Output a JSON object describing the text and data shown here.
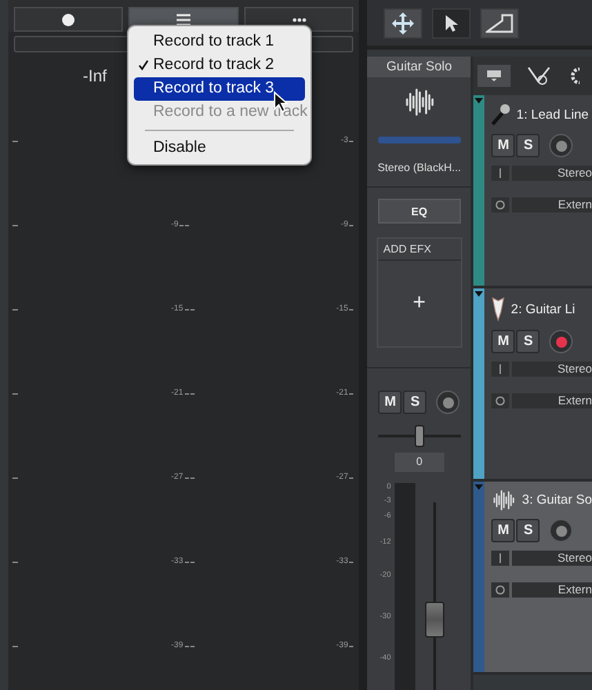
{
  "meter_panel": {
    "peak": "-Inf",
    "center_scale": [
      "-9",
      "-15",
      "-21",
      "-27",
      "-33",
      "-39"
    ],
    "right_scale": [
      "-3",
      "-9",
      "-15",
      "-21",
      "-27",
      "-33",
      "-39"
    ]
  },
  "menu": {
    "items": [
      {
        "kind": "item",
        "label": "Record to track 1",
        "checked": false,
        "selected": false,
        "disabled": false
      },
      {
        "kind": "item",
        "label": "Record to track 2",
        "checked": true,
        "selected": false,
        "disabled": false
      },
      {
        "kind": "item",
        "label": "Record to track 3",
        "checked": false,
        "selected": true,
        "disabled": false
      },
      {
        "kind": "item",
        "label": "Record to a new track",
        "checked": false,
        "selected": false,
        "disabled": true
      },
      {
        "kind": "separator"
      },
      {
        "kind": "item",
        "label": "Disable",
        "checked": false,
        "selected": false,
        "disabled": false
      }
    ]
  },
  "tools": [
    {
      "kind": "move",
      "selected": false
    },
    {
      "kind": "pointer",
      "selected": true
    },
    {
      "kind": "automation",
      "selected": false
    }
  ],
  "channel": {
    "name": "Guitar Solo",
    "output": "Stereo (BlackH...",
    "eq": "EQ",
    "add_efx": "ADD EFX",
    "add": "+",
    "mute": "M",
    "solo": "S",
    "armed": false,
    "pan": {
      "level": 0.5
    },
    "pan_value": "0",
    "scale": [
      "0",
      "-3",
      "-6",
      "-12",
      "-20",
      "-30",
      "-40"
    ],
    "fader": {
      "level": 0.35
    }
  },
  "tracks": [
    {
      "name": "1: Lead Line",
      "kind": "mic",
      "color": "#2e8b84",
      "selected": false,
      "armed": false,
      "mute": "M",
      "solo": "S",
      "input": "Stereo",
      "output": "Extern"
    },
    {
      "name": "2: Guitar Li",
      "kind": "guitar",
      "color": "#4fa3c4",
      "selected": false,
      "armed": true,
      "mute": "M",
      "solo": "S",
      "input": "Stereo",
      "output": "Extern"
    },
    {
      "name": "3: Guitar So",
      "kind": "wave",
      "color": "#2f5a8c",
      "selected": true,
      "armed": false,
      "mute": "M",
      "solo": "S",
      "input": "Stereo",
      "output": "Extern"
    }
  ]
}
